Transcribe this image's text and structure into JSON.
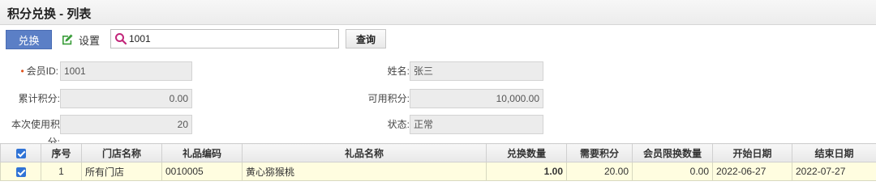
{
  "window": {
    "title": "积分兑换 - 列表"
  },
  "toolbar": {
    "exchange_label": "兑换",
    "settings_label": "设置",
    "search_value": "1001",
    "query_label": "查询"
  },
  "form": {
    "member_id": {
      "label": "会员ID:",
      "value": "1001"
    },
    "name": {
      "label": "姓名:",
      "value": "张三"
    },
    "total_points": {
      "label": "累计积分:",
      "value": "0.00"
    },
    "available_points": {
      "label": "可用积分:",
      "value": "10,000.00"
    },
    "used_points": {
      "label": "本次使用积分:",
      "value": "20"
    },
    "status": {
      "label": "状态:",
      "value": "正常"
    }
  },
  "table": {
    "headers": [
      "序号",
      "门店名称",
      "礼品编码",
      "礼品名称",
      "兑换数量",
      "需要积分",
      "会员限换数量",
      "开始日期",
      "结束日期"
    ],
    "rows": [
      {
        "index": "1",
        "store": "所有门店",
        "gift_code": "0010005",
        "gift_name": "黄心猕猴桃",
        "quantity": "1.00",
        "points": "20.00",
        "limit": "0.00",
        "start": "2022-06-27",
        "end": "2022-07-27"
      }
    ]
  },
  "colors": {
    "primary_button": "#5b7fc6",
    "row_highlight": "#fffde0",
    "checkbox": "#2f73d6",
    "required_mark": "#e0531e"
  },
  "icons": {
    "settings": "edit-icon",
    "search": "search-icon",
    "checkbox": "checkbox-checked-icon"
  }
}
